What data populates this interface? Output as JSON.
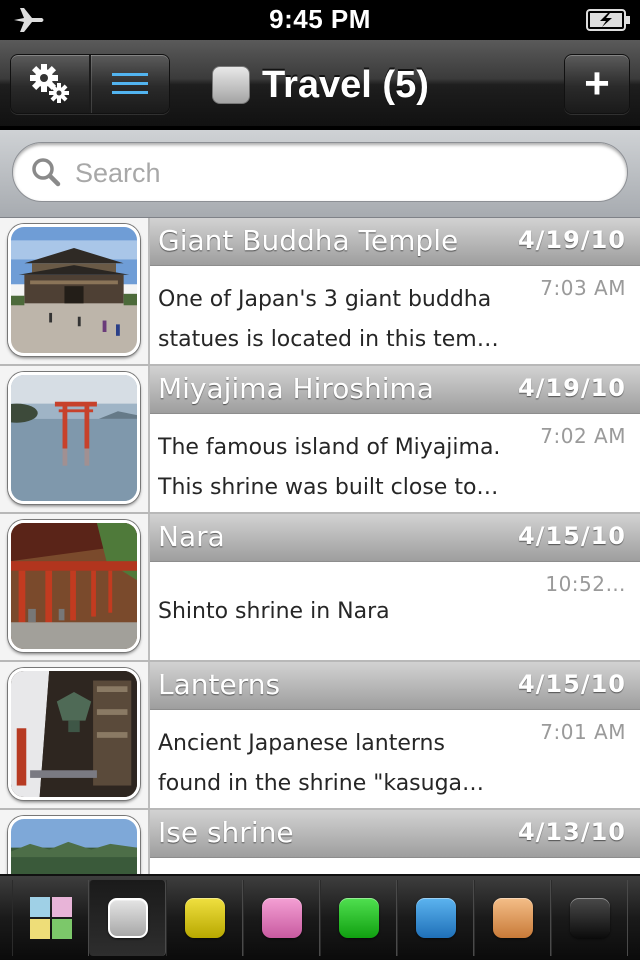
{
  "status_bar": {
    "time": "9:45 PM"
  },
  "nav": {
    "title": "Travel (5)",
    "add_label": "+"
  },
  "search": {
    "placeholder": "Search",
    "value": ""
  },
  "entries": [
    {
      "title": "Giant Buddha Temple",
      "date": "4/19/10",
      "time": "7:03 AM",
      "line1": "One of Japan's 3 giant buddha",
      "line2": "statues is located in this tem…",
      "thumb": "temple"
    },
    {
      "title": "Miyajima Hiroshima",
      "date": "4/19/10",
      "time": "7:02 AM",
      "line1": "The famous island of Miyajima.",
      "line2": "This shrine was built close to…",
      "thumb": "torii"
    },
    {
      "title": "Nara",
      "date": "4/15/10",
      "time": "10:52…",
      "line1": "Shinto shrine in Nara",
      "line2": "",
      "thumb": "shrine"
    },
    {
      "title": "Lanterns",
      "date": "4/15/10",
      "time": "7:01 AM",
      "line1": "Ancient Japanese lanterns",
      "line2": "found in the shrine \"kasuga…",
      "thumb": "lanterns"
    },
    {
      "title": "Ise shrine",
      "date": "4/13/10",
      "time": "",
      "line1": "",
      "line2": "",
      "thumb": "forest"
    }
  ],
  "tabs": [
    {
      "name": "all",
      "color": "#multi"
    },
    {
      "name": "gray",
      "color": "#c2c2c2",
      "active": true
    },
    {
      "name": "yellow",
      "color": "#d8c818"
    },
    {
      "name": "pink",
      "color": "#e070b8"
    },
    {
      "name": "green",
      "color": "#28c028"
    },
    {
      "name": "blue",
      "color": "#2f8fd8"
    },
    {
      "name": "orange",
      "color": "#e09a58"
    },
    {
      "name": "black",
      "color": "#222222"
    }
  ]
}
